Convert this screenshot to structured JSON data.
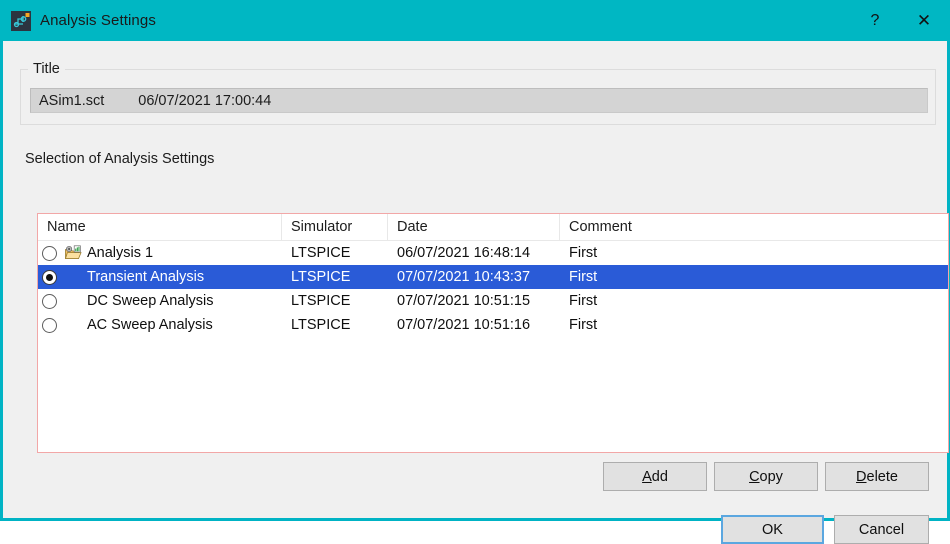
{
  "window": {
    "title": "Analysis Settings",
    "icon": "analysis-app-icon",
    "help_label": "?",
    "close_label": "✕",
    "accent_color": "#00b7c3"
  },
  "title_group": {
    "label": "Title",
    "file_name": "ASim1.sct",
    "file_timestamp": "06/07/2021 17:00:44"
  },
  "selection_group": {
    "label": "Selection of Analysis Settings",
    "border_color": "#f2a7a7",
    "selection_color": "#2a5bd7",
    "columns": [
      {
        "key": "name",
        "label": "Name"
      },
      {
        "key": "simulator",
        "label": "Simulator"
      },
      {
        "key": "date",
        "label": "Date"
      },
      {
        "key": "comment",
        "label": "Comment"
      }
    ],
    "rows": [
      {
        "name": "Analysis 1",
        "simulator": "LTSPICE",
        "date": "06/07/2021 16:48:14",
        "comment": "First",
        "icon": "folder-gear-icon",
        "selected": false
      },
      {
        "name": "Transient Analysis",
        "simulator": "LTSPICE",
        "date": "07/07/2021 10:43:37",
        "comment": "First",
        "icon": "",
        "selected": true
      },
      {
        "name": "DC Sweep Analysis",
        "simulator": "LTSPICE",
        "date": "07/07/2021 10:51:15",
        "comment": "First",
        "icon": "",
        "selected": false
      },
      {
        "name": "AC Sweep Analysis",
        "simulator": "LTSPICE",
        "date": "07/07/2021 10:51:16",
        "comment": "First",
        "icon": "",
        "selected": false
      }
    ]
  },
  "list_actions": {
    "add": {
      "mnemonic": "A",
      "rest": "dd"
    },
    "copy": {
      "mnemonic": "C",
      "rest": "opy"
    },
    "delete": {
      "mnemonic": "D",
      "rest": "elete"
    }
  },
  "dialog_actions": {
    "ok": "OK",
    "cancel": "Cancel"
  }
}
